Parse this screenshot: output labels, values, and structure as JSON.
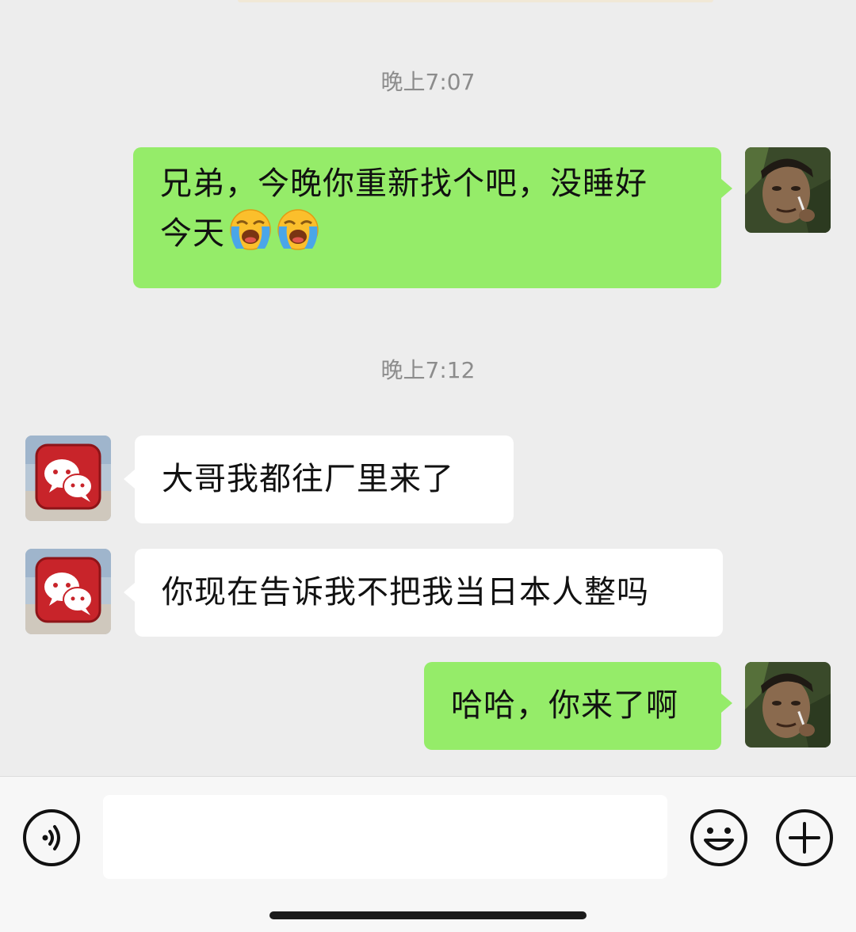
{
  "messages": [
    {
      "kind": "timestamp",
      "text": "晚上7:07"
    },
    {
      "kind": "message",
      "side": "self",
      "line1": "兄弟，今晚你重新找个吧，没睡好",
      "line2": "今天",
      "emojis": [
        "loudly-crying-face-emoji",
        "loudly-crying-face-emoji"
      ]
    },
    {
      "kind": "timestamp",
      "text": "晚上7:12"
    },
    {
      "kind": "message",
      "side": "other",
      "text": "大哥我都往厂里来了"
    },
    {
      "kind": "message",
      "side": "other",
      "text": "你现在告诉我不把我当日本人整吗"
    },
    {
      "kind": "message",
      "side": "self",
      "text": "哈哈，你来了啊"
    }
  ],
  "input": {
    "value": "",
    "placeholder": ""
  },
  "icons": {
    "voice": "voice-mode-icon",
    "emoji": "emoji-icon",
    "more": "plus-icon"
  },
  "colors": {
    "background": "#ededed",
    "self_bubble": "#95ec69",
    "other_bubble": "#ffffff",
    "timestamp_text": "#8c8c8c",
    "other_avatar": "#c8242a"
  }
}
